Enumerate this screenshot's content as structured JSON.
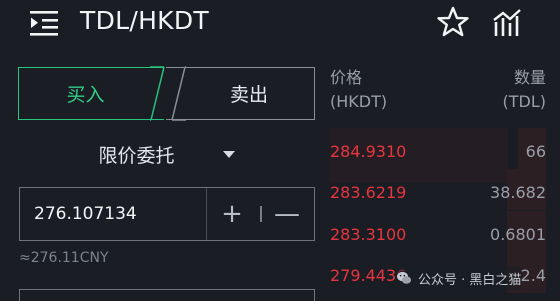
{
  "header": {
    "title": "TDL/HKDT",
    "menu_icon": "list-indent-icon",
    "favorite_icon": "star-outline-icon",
    "chart_icon": "bar-chart-icon"
  },
  "trade": {
    "buy_tab": "买入",
    "sell_tab": "卖出",
    "order_type": "限价委托",
    "price_value": "276.107134",
    "plus": "+",
    "minus": "—",
    "approx_cny": "≈276.11CNY"
  },
  "orderbook": {
    "price_header": "价格",
    "price_unit": "(HKDT)",
    "qty_header": "数量",
    "qty_unit": "(TDL)",
    "asks": [
      {
        "price": "284.9310",
        "qty": "66",
        "depth": 0.13
      },
      {
        "price": "283.6219",
        "qty": "38.682",
        "depth": 0.18
      },
      {
        "price": "283.3100",
        "qty": "0.6801",
        "depth": 0.18
      },
      {
        "price": "279.4436",
        "qty": "2.4",
        "depth": 0.18
      }
    ]
  },
  "watermark": {
    "text": "公众号 · 黑白之猫",
    "icon": "wechat-icon"
  },
  "colors": {
    "background": "#1a1d24",
    "buy": "#27c47f",
    "ask": "#e8353e",
    "ask_depth": "#2b1f24"
  }
}
